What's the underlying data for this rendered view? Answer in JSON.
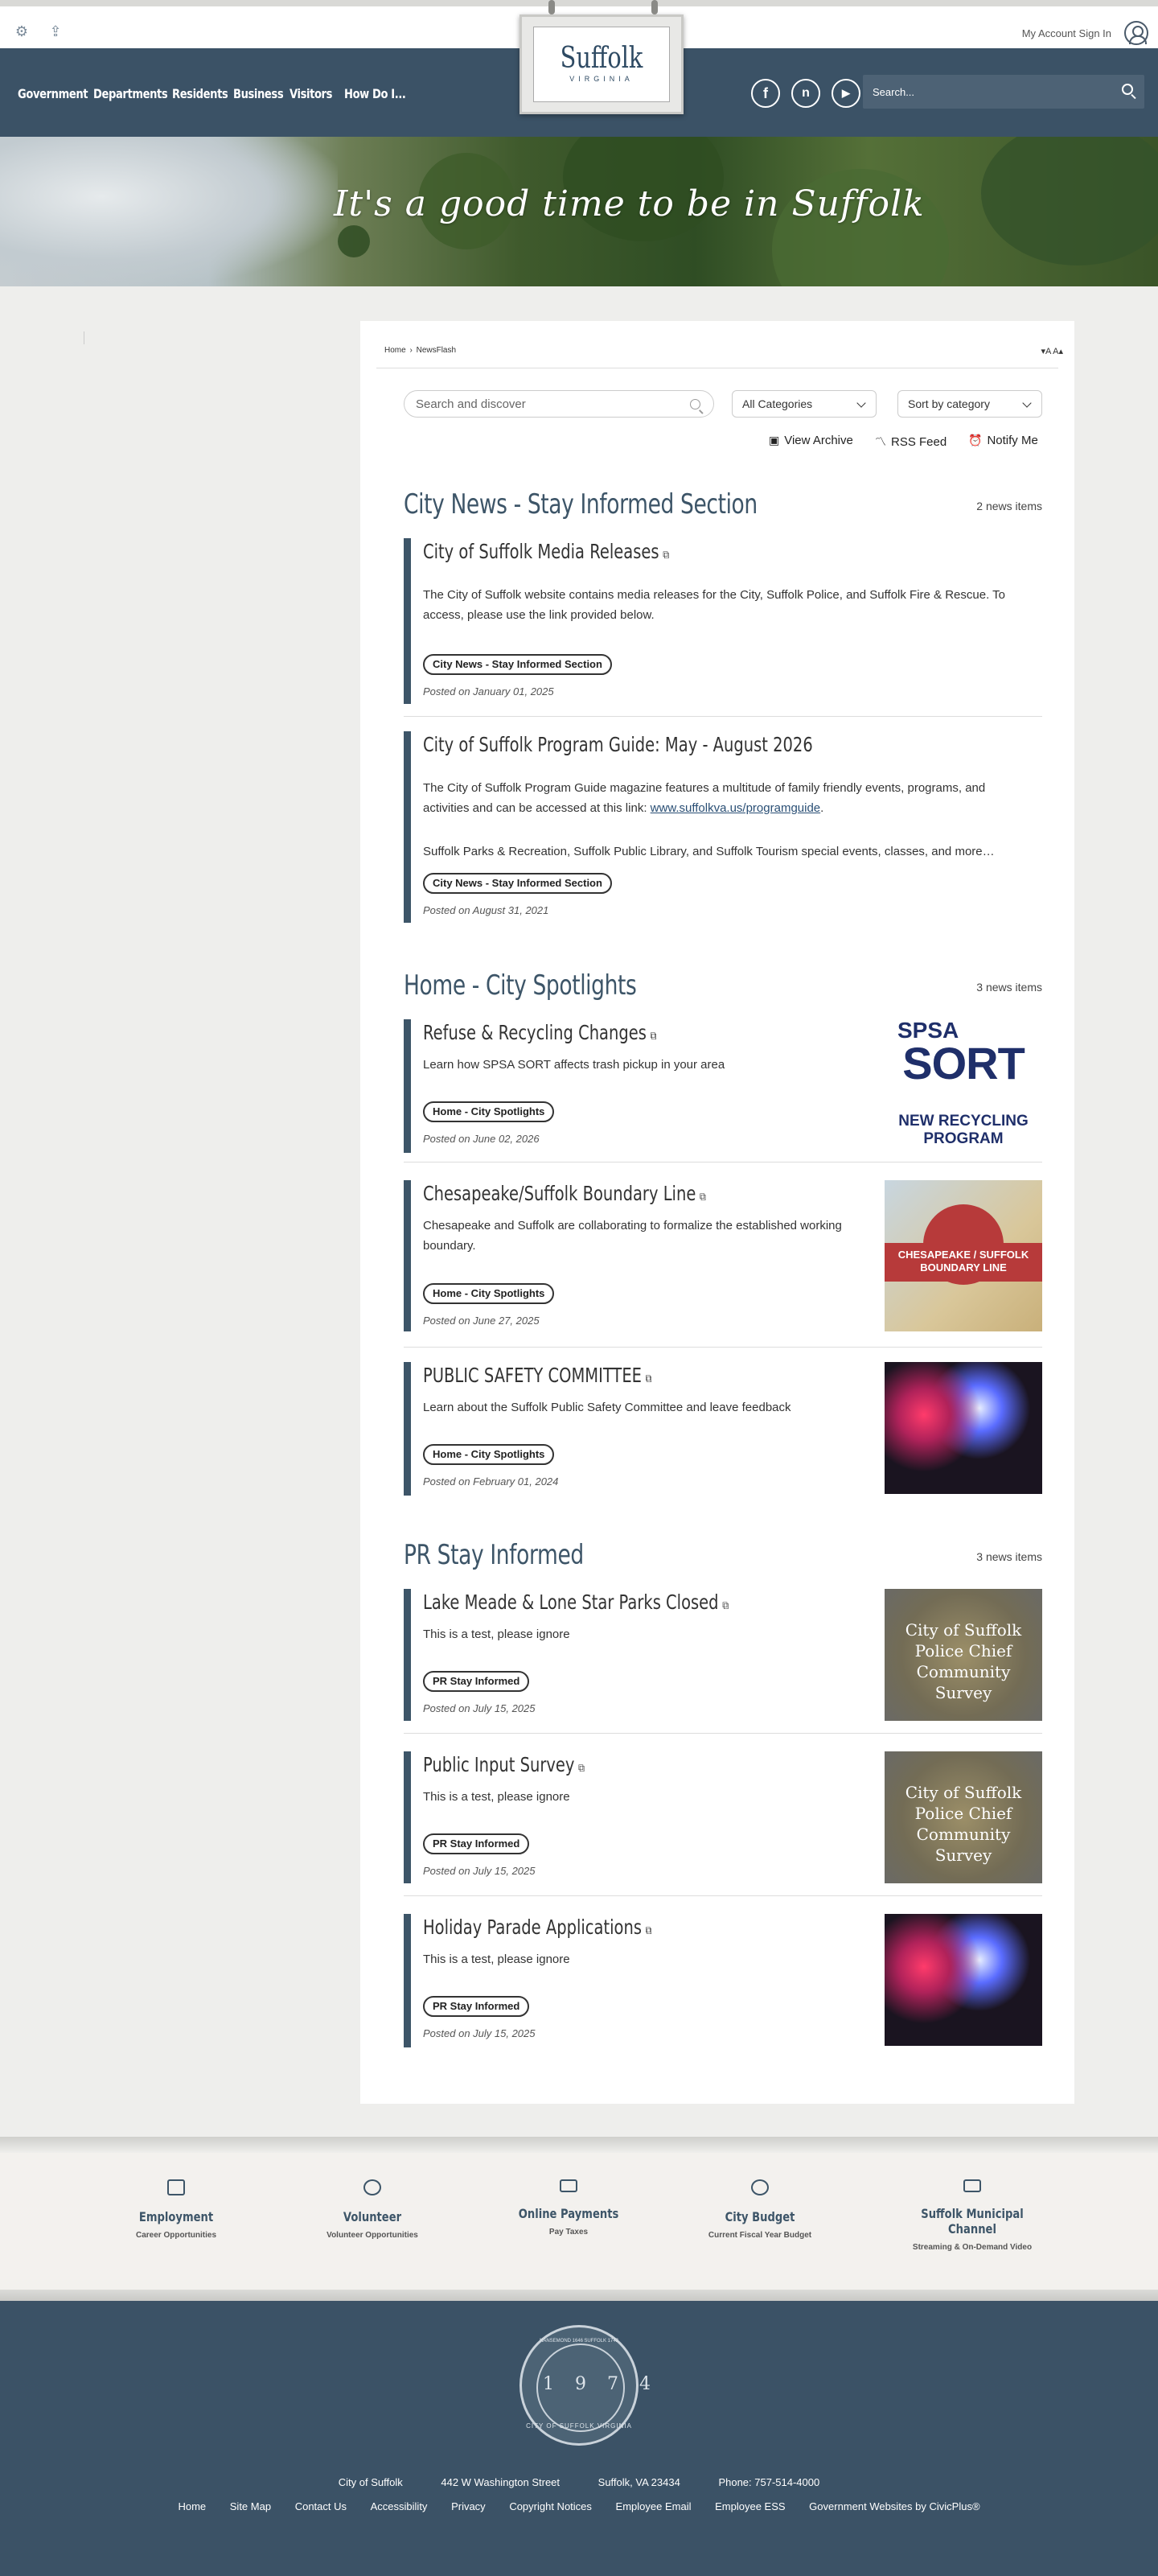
{
  "topbar": {
    "account_label": "My Account Sign In",
    "icons": [
      "gear-icon",
      "share-icon",
      "user-icon"
    ]
  },
  "nav": {
    "items": [
      "Government",
      "Departments",
      "Residents",
      "Business",
      "Visitors",
      "How Do I..."
    ],
    "logo": {
      "name": "Suffolk",
      "sub": "VIRGINIA"
    },
    "social": [
      "facebook-icon",
      "nextdoor-icon",
      "youtube-icon"
    ],
    "search_placeholder": "Search..."
  },
  "banner": {
    "tagline": "It's a good time to be in Suffolk"
  },
  "breadcrumb": {
    "home": "Home",
    "sep": "›",
    "current": "NewsFlash"
  },
  "font_controls": "▾A  A▴",
  "filters": {
    "search_placeholder": "Search and discover",
    "category": "All Categories",
    "sort": "Sort by category"
  },
  "tools": {
    "archive": "View Archive",
    "rss": "RSS Feed",
    "notify": "Notify Me"
  },
  "sections": [
    {
      "title": "City News - Stay Informed Section",
      "count": "2 news items",
      "items": [
        {
          "title": "City of Suffolk Media Releases",
          "desc": "The City of Suffolk website contains media releases for the City, Suffolk Police, and Suffolk Fire & Rescue. To access, please use the link provided below.",
          "tag": "City News - Stay Informed Section",
          "date": "Posted on January 01, 2025"
        },
        {
          "title": "City of Suffolk Program Guide: May - August 2026",
          "desc1": "The City of Suffolk Program Guide magazine features a multitude of family friendly events, programs, and activities and can be accessed at this link: ",
          "link": "www.suffolkva.us/programguide",
          "desc2": "Suffolk Parks & Recreation, Suffolk Public Library, and Suffolk Tourism special events, classes, and more…",
          "tag": "City News - Stay Informed Section",
          "date": "Posted on August 31, 2021"
        }
      ]
    },
    {
      "title": "Home - City Spotlights",
      "count": "3 news items",
      "items": [
        {
          "title": "Refuse & Recycling Changes",
          "desc": "Learn how SPSA SORT affects trash pickup in your area",
          "tag": "Home - City Spotlights",
          "date": "Posted on June 02, 2026",
          "img": {
            "l1": "SPSA",
            "l2": "SORT",
            "l3": "NEW RECYCLING",
            "l4": "PROGRAM"
          }
        },
        {
          "title": "Chesapeake/Suffolk Boundary Line",
          "desc": "Chesapeake and Suffolk are collaborating to formalize the established working boundary.",
          "tag": "Home - City Spotlights",
          "date": "Posted on June 27, 2025",
          "img": {
            "l1": "CHESAPEAKE / SUFFOLK",
            "l2": "BOUNDARY LINE"
          }
        },
        {
          "title": "PUBLIC SAFETY COMMITTEE",
          "desc": "Learn about the Suffolk Public Safety Committee and leave feedback",
          "tag": "Home - City Spotlights",
          "date": "Posted on February 01, 2024"
        }
      ]
    },
    {
      "title": "PR Stay Informed",
      "count": "3 news items",
      "items": [
        {
          "title": "Lake Meade & Lone Star Parks Closed",
          "desc": "This is a test, please ignore",
          "tag": "PR Stay Informed",
          "date": "Posted on July 15, 2025",
          "img": "City of Suffolk Police Chief Community Survey"
        },
        {
          "title": "Public Input Survey",
          "desc": "This is a test, please ignore",
          "tag": "PR Stay Informed",
          "date": "Posted on July 15, 2025",
          "img": "City of Suffolk Police Chief Community Survey"
        },
        {
          "title": "Holiday Parade Applications",
          "desc": "This is a test, please ignore",
          "tag": "PR Stay Informed",
          "date": "Posted on July 15, 2025"
        }
      ]
    }
  ],
  "quick_links": [
    {
      "title": "Employment",
      "sub": "Career Opportunities",
      "icon": "briefcase-icon"
    },
    {
      "title": "Volunteer",
      "sub": "Volunteer Opportunities",
      "icon": "people-icon"
    },
    {
      "title": "Online Payments",
      "sub": "Pay Taxes",
      "icon": "credit-card-icon"
    },
    {
      "title": "City Budget",
      "sub": "Current Fiscal Year Budget",
      "icon": "pie-chart-icon"
    },
    {
      "title": "Suffolk Municipal Channel",
      "sub": "Streaming & On-Demand Video",
      "icon": "monitor-icon"
    }
  ],
  "footer": {
    "seal": {
      "year": "1974",
      "top_left": "NANSEMOND 1646",
      "top_right": "SUFFOLK 1742",
      "ring": "CITY OF SUFFOLK VIRGINIA"
    },
    "address": [
      "City of Suffolk",
      "442 W Washington Street",
      "Suffolk, VA 23434",
      "Phone: 757-514-4000"
    ],
    "links": [
      "Home",
      "Site Map",
      "Contact Us",
      "Accessibility",
      "Privacy",
      "Copyright Notices",
      "Employee Email",
      "Employee ESS",
      "Government Websites by CivicPlus®"
    ]
  }
}
